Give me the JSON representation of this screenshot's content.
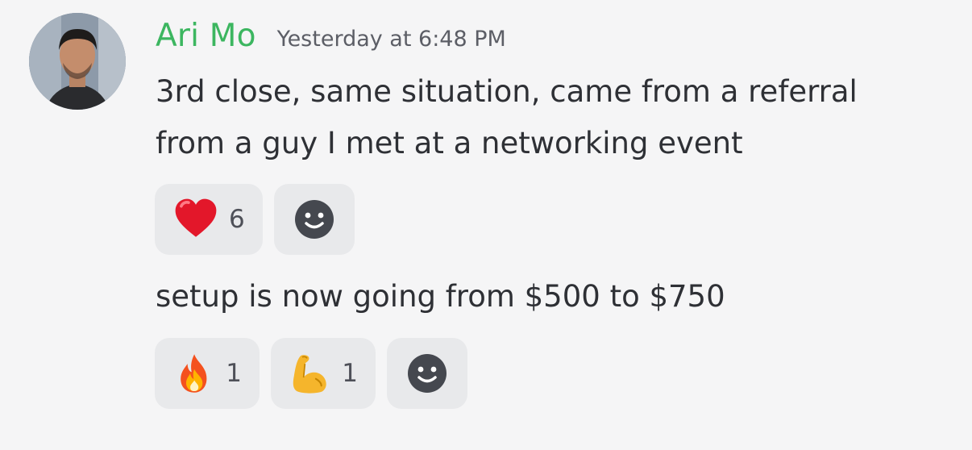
{
  "message": {
    "author": "Ari Mo",
    "author_color": "#3cb660",
    "timestamp": "Yesterday at 6:48 PM",
    "avatar_icon": "user-photo",
    "lines": [
      {
        "text_line1": "3rd close, same situation, came from a referral",
        "text_line2": "from a guy I met at a networking event",
        "reactions": [
          {
            "emoji": "heart",
            "count": "6"
          }
        ],
        "add_reaction_icon": "smiley-face-icon"
      },
      {
        "text_line1": "setup is now going from $500 to $750",
        "reactions": [
          {
            "emoji": "fire",
            "count": "1"
          },
          {
            "emoji": "flexed-biceps",
            "count": "1"
          }
        ],
        "add_reaction_icon": "smiley-face-icon"
      }
    ]
  }
}
